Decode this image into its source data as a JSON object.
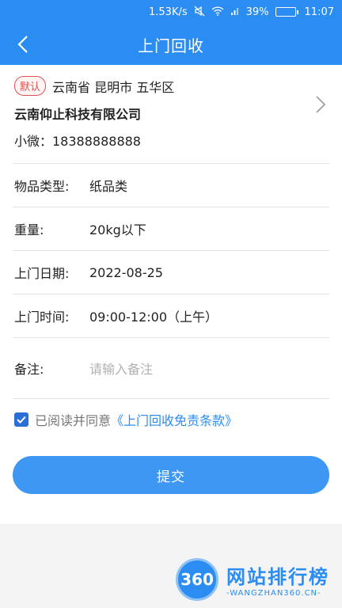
{
  "status_bar": {
    "speed": "1.53K/s",
    "battery_pct": "39%",
    "time": "11:07"
  },
  "header": {
    "title": "上门回收"
  },
  "address": {
    "badge": "默认",
    "region": "云南省 昆明市 五华区",
    "company": "云南仰止科技有限公司",
    "contact": "小微：18388888888"
  },
  "form": {
    "rows": [
      {
        "label": "物品类型:",
        "value": "纸品类"
      },
      {
        "label": "重量:",
        "value": "20kg以下"
      },
      {
        "label": "上门日期:",
        "value": "2022-08-25"
      },
      {
        "label": "上门时间:",
        "value": "09:00-12:00（上午）"
      }
    ],
    "note_label": "备注:",
    "note_placeholder": "请输入备注"
  },
  "agreement": {
    "checked": true,
    "text": "已阅读并同意",
    "link": "《上门回收免责条款》"
  },
  "submit_label": "提交",
  "watermark": {
    "logo": "360",
    "main": "网站排行榜",
    "sub": "-WANGZHAN360.CN-"
  },
  "colors": {
    "brand": "#2b8cf2",
    "button": "#3e98f3",
    "badge": "#e05050"
  }
}
